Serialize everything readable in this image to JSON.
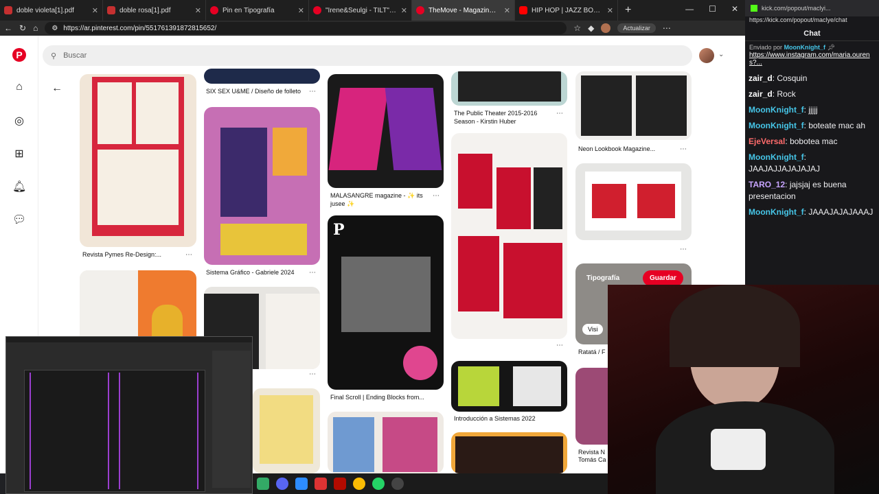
{
  "tabs": [
    {
      "label": "doble violeta[1].pdf",
      "color": "#c53030"
    },
    {
      "label": "doble rosa[1].pdf",
      "color": "#c53030"
    },
    {
      "label": "Pin en Tipografía",
      "color": "#e60023"
    },
    {
      "label": "\"Irene&Seulgi - TILT\" Magazine",
      "color": "#e60023"
    },
    {
      "label": "TheMove - Magazine Design -",
      "color": "#e60023"
    },
    {
      "label": "HIP HOP | JAZZ BOOM B",
      "color": "#ff0000"
    }
  ],
  "url": "https://ar.pinterest.com/pin/551761391872815652/",
  "actualizar": "Actualizar",
  "search_placeholder": "Buscar",
  "pins": {
    "p1": "Revista Pymes Re-Design:...",
    "p2": "SIX SEX U&ME / Diseño de folleto",
    "p3": "Sistema Gráfico - Gabriele 2024",
    "p4": "MALASANGRE magazine - ✨ its",
    "p4b": "jusee ✨",
    "p5": "The Public Theater 2015-2016",
    "p5b": "Season - Kirstin Huber",
    "p6": "Neon Lookbook Magazine...",
    "p7": "Final Scroll | Ending Blocks from...",
    "p8": "Introducción a Sistemas 2022",
    "p9": "Ratatá / F",
    "p10": "Revista N",
    "p10b": "Tomás Ca",
    "hover_board": "Tipografía",
    "save": "Guardar",
    "visit": "Visi"
  },
  "chat": {
    "top_url": "kick.com/popout/maclyi...",
    "url": "https://kick.com/popout/maclye/chat",
    "title": "Chat",
    "sent_by": "Enviado por",
    "sent_user": "MoonKnight_f",
    "link": "https://www.instagram.com/maria.ourens?...",
    "messages": [
      {
        "user": "zair_d",
        "text": "Cosquin",
        "color": "#ffffff"
      },
      {
        "user": "zair_d",
        "text": "Rock",
        "color": "#ffffff"
      },
      {
        "user": "MoonKnight_f",
        "text": "jjjjj",
        "color": "#46c6e8"
      },
      {
        "user": "MoonKnight_f",
        "text": "boteate mac ah",
        "color": "#46c6e8"
      },
      {
        "user": "EjeVersal",
        "text": "bobotea mac",
        "color": "#ff6b6b"
      },
      {
        "user": "MoonKnight_f",
        "text": "JAAJAJJAJAJAJAJ",
        "color": "#46c6e8"
      },
      {
        "user": "TARO_12",
        "text": "jajsjaj es buena presentacion",
        "color": "#c7a4ff"
      },
      {
        "user": "MoonKnight_f",
        "text": "JAAAJAJAJAAAJ",
        "color": "#46c6e8"
      }
    ]
  },
  "colors": {
    "accent": "#e60023",
    "chat_bg": "#18181b"
  }
}
